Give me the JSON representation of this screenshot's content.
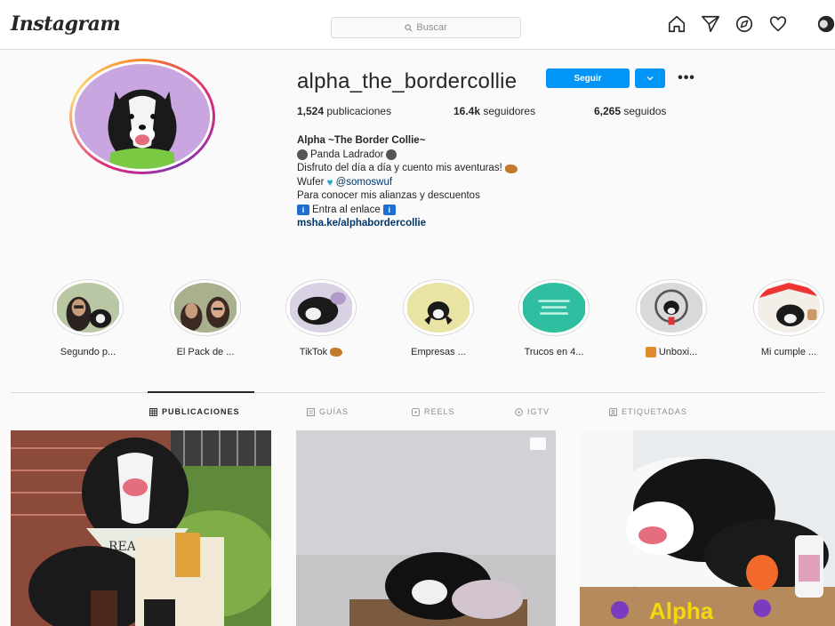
{
  "header": {
    "logo": "Instagram",
    "search_placeholder": "Buscar",
    "icons": [
      "home-icon",
      "direct-icon",
      "explore-icon",
      "activity-icon",
      "profile-avatar"
    ]
  },
  "profile": {
    "username": "alpha_the_bordercollie",
    "follow_label": "Seguir",
    "stats": {
      "posts_value": "1,524",
      "posts_label": "publicaciones",
      "followers_value": "16.4k",
      "followers_label": "seguidores",
      "following_value": "6,265",
      "following_label": "seguidos"
    },
    "bio": {
      "name": "Alpha ~The Border Collie~",
      "line1": "Panda Ladrador",
      "line2": "Disfruto del día a día y cuento mis aventuras!",
      "line3_prefix": "Wufer",
      "line3_mention": "@somoswuf",
      "line4": "Para conocer mis alianzas y descuentos",
      "line5": "Entra al enlace",
      "link": "msha.ke/alphabordercollie"
    }
  },
  "highlights": [
    {
      "label": "Segundo p..."
    },
    {
      "label": "El Pack de ..."
    },
    {
      "label": "TikTok"
    },
    {
      "label": "Empresas ..."
    },
    {
      "label": "Trucos en 4..."
    },
    {
      "label": "Unboxi..."
    },
    {
      "label": "Mi cumple ..."
    }
  ],
  "tabs": [
    {
      "label": "PUBLICACIONES",
      "active": true
    },
    {
      "label": "GUÍAS",
      "active": false
    },
    {
      "label": "REELS",
      "active": false
    },
    {
      "label": "IGTV",
      "active": false
    },
    {
      "label": "ETIQUETADAS",
      "active": false
    }
  ],
  "colors": {
    "accent": "#0095f6",
    "link": "#00376b"
  }
}
